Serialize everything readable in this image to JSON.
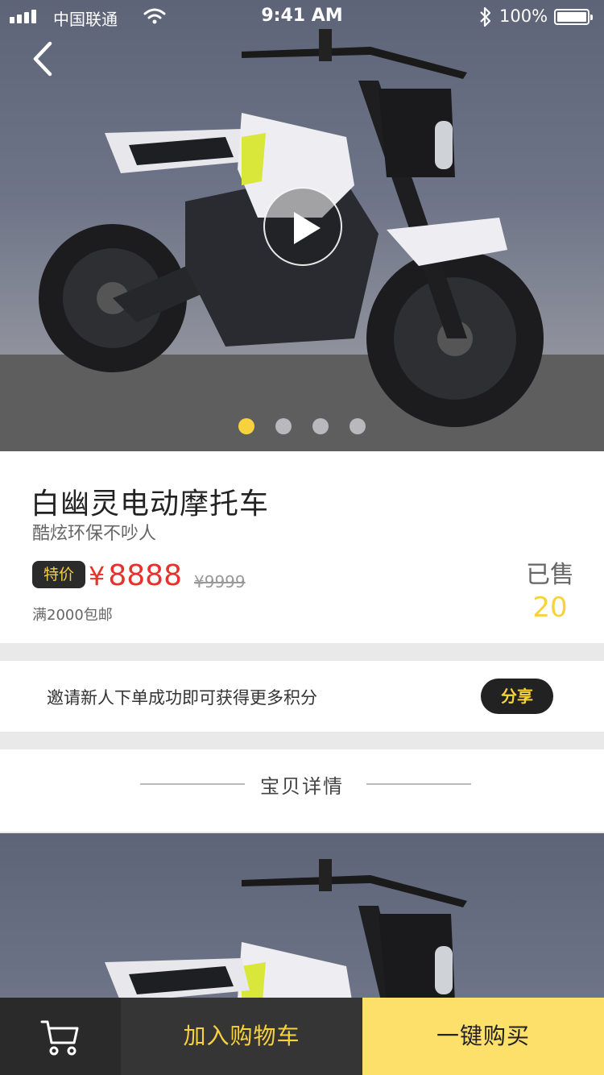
{
  "status_bar": {
    "carrier": "中国联通",
    "time": "9:41 AM",
    "battery": "100%"
  },
  "gallery": {
    "image_count": 4,
    "active_index": 0,
    "dot_active_color": "#f7d23e"
  },
  "product": {
    "title": "白幽灵电动摩托车",
    "subtitle": "酷炫环保不吵人",
    "tag": "特价",
    "currency": "¥",
    "price": "8888",
    "original_price": "¥9999",
    "shipping": "满2000包邮",
    "sold_label": "已售",
    "sold_count": "20"
  },
  "invite": {
    "text": "邀请新人下单成功即可获得更多积分",
    "share_label": "分享"
  },
  "details": {
    "title": "宝贝详情"
  },
  "bottom_bar": {
    "add_to_cart": "加入购物车",
    "buy_now": "一键购买"
  },
  "colors": {
    "accent_yellow": "#f7d23e",
    "price_red": "#e8312c",
    "dark": "#2a2a2a"
  },
  "icons": [
    "signal-icon",
    "wifi-icon",
    "bluetooth-icon",
    "battery-icon",
    "back-arrow-icon",
    "play-icon",
    "cart-icon"
  ]
}
